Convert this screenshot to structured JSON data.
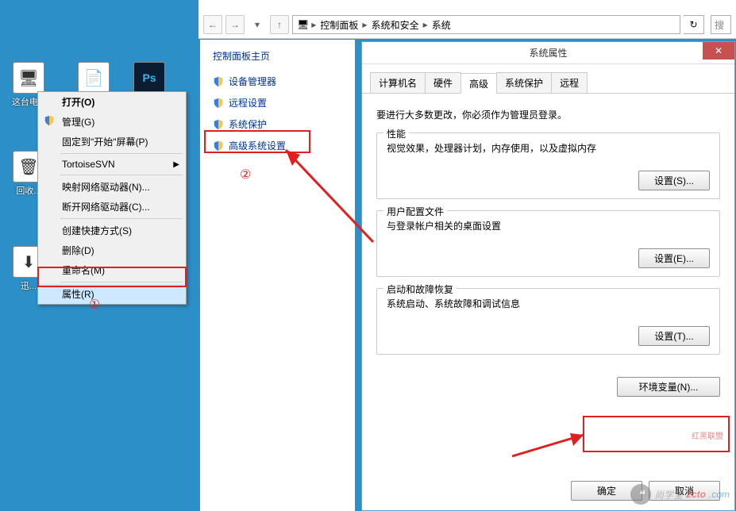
{
  "desktop": {
    "icons": [
      {
        "label": "这台电..."
      },
      {
        "label": "回收..."
      },
      {
        "label": "迅..."
      }
    ]
  },
  "context_menu": {
    "items": [
      {
        "label": "打开(O)",
        "bold": true
      },
      {
        "label": "管理(G)",
        "shield": true
      },
      {
        "label": "固定到\"开始\"屏幕(P)"
      },
      {
        "label": "TortoiseSVN",
        "submenu": true
      },
      {
        "label": "映射网络驱动器(N)..."
      },
      {
        "label": "断开网络驱动器(C)..."
      },
      {
        "label": "创建快捷方式(S)"
      },
      {
        "label": "删除(D)"
      },
      {
        "label": "重命名(M)"
      },
      {
        "label": "属性(R)"
      }
    ]
  },
  "breadcrumb": {
    "parts": [
      "控制面板",
      "系统和安全",
      "系统"
    ]
  },
  "search": {
    "placeholder": "搜"
  },
  "control_panel": {
    "title": "控制面板主页",
    "links": [
      "设备管理器",
      "远程设置",
      "系统保护",
      "高级系统设置"
    ]
  },
  "dialog": {
    "title": "系统属性",
    "tabs": [
      "计算机名",
      "硬件",
      "高级",
      "系统保护",
      "远程"
    ],
    "active_tab": 2,
    "intro": "要进行大多数更改，你必须作为管理员登录。",
    "groups": [
      {
        "title": "性能",
        "desc": "视觉效果，处理器计划，内存使用，以及虚拟内存",
        "btn": "设置(S)..."
      },
      {
        "title": "用户配置文件",
        "desc": "与登录帐户相关的桌面设置",
        "btn": "设置(E)..."
      },
      {
        "title": "启动和故障恢复",
        "desc": "系统启动、系统故障和调试信息",
        "btn": "设置(T)..."
      }
    ],
    "env_btn": "环境变量(N)...",
    "footer": [
      "确定",
      "取消"
    ]
  },
  "annotations": {
    "one": "①",
    "two": "②"
  },
  "watermark": {
    "t1": "尚学堂",
    "t2": "2cto",
    "t3": ".com",
    "mini": "红黑联盟"
  }
}
